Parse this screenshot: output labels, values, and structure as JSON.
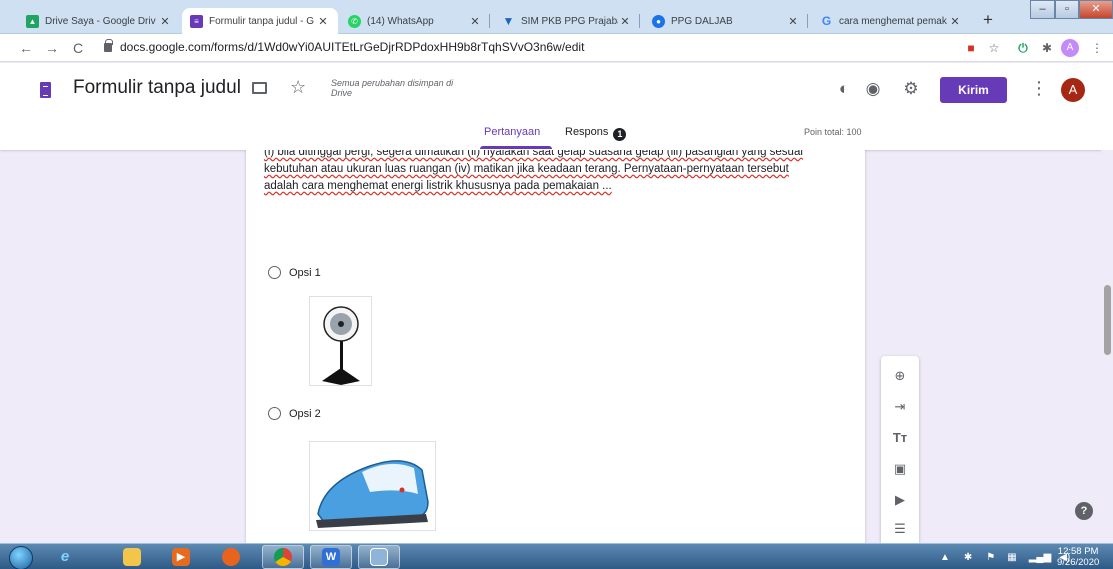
{
  "browser": {
    "tabs": [
      {
        "title": "Drive Saya - Google Driv",
        "favicon": "google-drive-icon",
        "color": "#1fa463",
        "active": false
      },
      {
        "title": "Formulir tanpa judul - G",
        "favicon": "google-forms-icon",
        "color": "#673ab7",
        "active": true
      },
      {
        "title": "(14) WhatsApp",
        "favicon": "whatsapp-icon",
        "color": "#25d366",
        "active": false
      },
      {
        "title": "SIM PKB PPG Prajabatan",
        "favicon": "vuetify-icon",
        "color": "#1867c0",
        "active": false
      },
      {
        "title": "PPG DALJAB",
        "favicon": "globe-icon",
        "color": "#1a73e8",
        "active": false
      },
      {
        "title": "cara menghemat pemak",
        "favicon": "google-g-icon",
        "color": "#4285f4",
        "active": false
      }
    ],
    "new_tab_label": "+",
    "url": "docs.google.com/forms/d/1Wd0wYi0AUITEtLrGeDjrRDPdoxHH9b8rTqhSVvO3n6w/edit",
    "profile_initial": "A"
  },
  "form": {
    "title": "Formulir tanpa judul",
    "save_status": "Semua perubahan disimpan di Drive",
    "send_label": "Kirim",
    "avatar_initial": "A",
    "tabs": [
      {
        "label": "Pertanyaan",
        "active": true
      },
      {
        "label": "Respons",
        "active": false,
        "badge": "1"
      }
    ],
    "total_points": "Poin total: 100",
    "accent_color": "#673ab7"
  },
  "question": {
    "text": "(i) bila ditinggal pergi, segera dimatikan (ii) nyalakan saat gelap suasana gelap (iii) pasanglah yang sesuai kebutuhan atau ukuran luas ruangan (iv) matikan jika keadaan terang. Pernyataan-pernyataan tersebut adalah cara menghemat energi listrik khususnya pada pemakaian ...",
    "required_mark": "*",
    "options": [
      {
        "label": "Opsi 1",
        "image": "standing-fan-image"
      },
      {
        "label": "Opsi 2",
        "image": "electric-iron-image"
      }
    ]
  },
  "side_toolbar": [
    "add-question-icon",
    "import-questions-icon",
    "add-title-icon",
    "add-image-icon",
    "add-video-icon",
    "add-section-icon"
  ],
  "help_label": "?",
  "taskbar": {
    "items": [
      "internet-explorer-icon",
      "file-explorer-icon",
      "media-player-icon",
      "firefox-icon",
      "chrome-icon",
      "wps-office-icon",
      "screenshot-tool-icon"
    ],
    "time": "12:58 PM",
    "date": "9/26/2020"
  }
}
